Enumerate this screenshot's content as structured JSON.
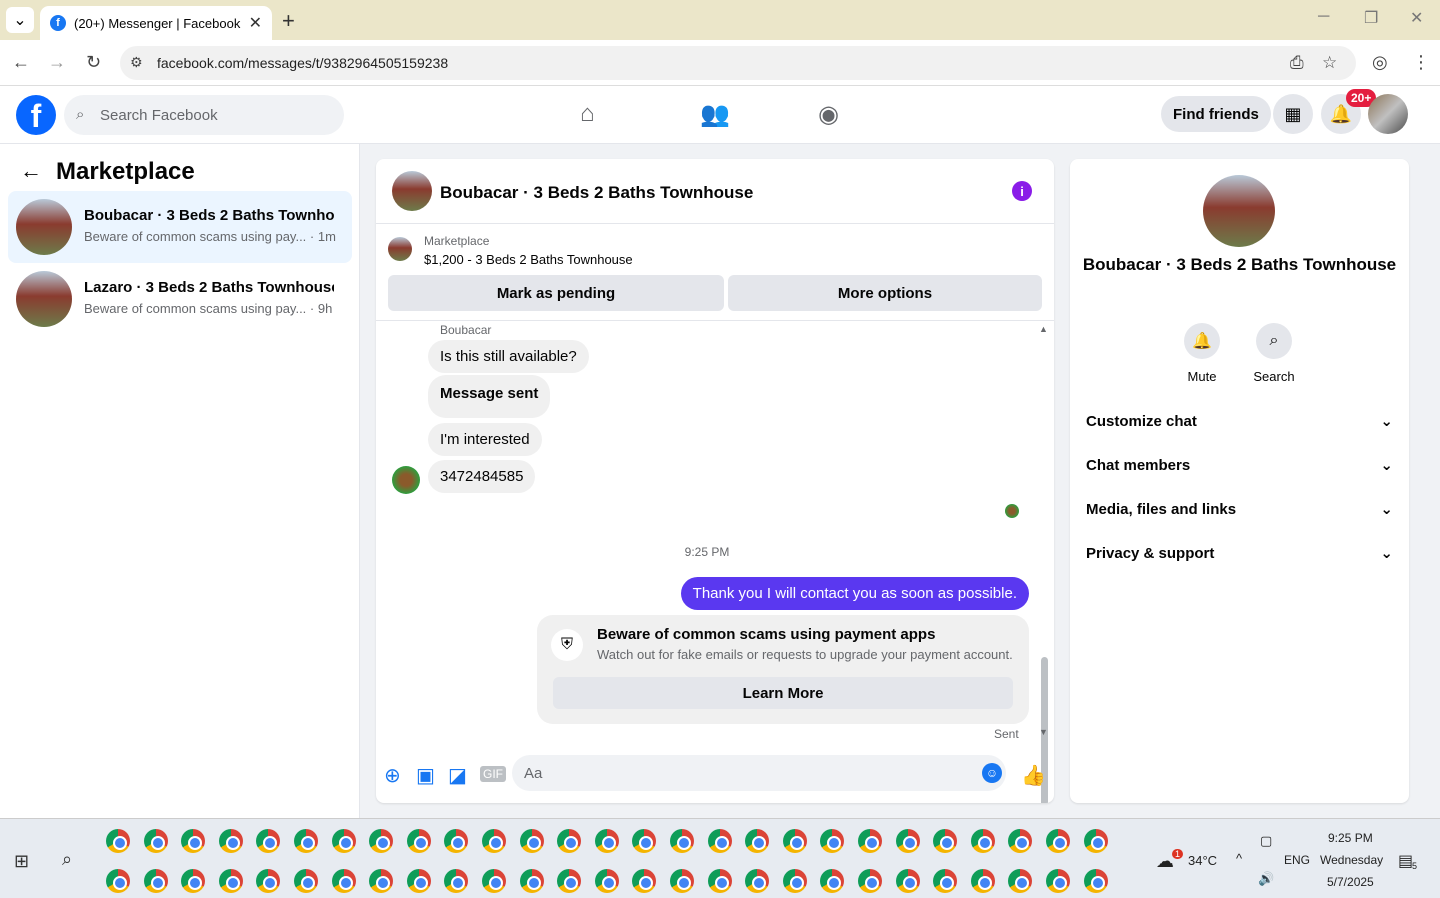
{
  "browser": {
    "tab_title": "(20+) Messenger | Facebook",
    "url": "facebook.com/messages/t/9382964505159238"
  },
  "fb": {
    "search_placeholder": "Search Facebook",
    "find_friends": "Find friends",
    "notif_badge": "20+"
  },
  "left": {
    "title": "Marketplace",
    "conversations": [
      {
        "name": "Boubacar · 3 Beds 2 Baths Townho...",
        "snippet": "Beware of common scams using pay... · 1m"
      },
      {
        "name": "Lazaro · 3 Beds 2 Baths Townhouse",
        "snippet": "Beware of common scams using pay... · 9h"
      }
    ]
  },
  "chat": {
    "title": "Boubacar · 3 Beds 2 Baths Townhouse",
    "listing_label": "Marketplace",
    "listing_price": "$1,200 - 3 Beds 2 Baths Townhouse",
    "mark_pending": "Mark as pending",
    "more_options": "More options",
    "sender": "Boubacar",
    "messages": [
      "Is this still available?",
      "Message sent",
      "I'm interested",
      "3472484585"
    ],
    "timestamp": "9:25 PM",
    "my_message": "Thank you I will contact  you as soon as possible.",
    "scam_title": "Beware of common scams using payment apps",
    "scam_desc": "Watch out for fake emails or requests to upgrade your payment account.",
    "learn_more": "Learn More",
    "sent_label": "Sent",
    "composer_placeholder": "Aa"
  },
  "right": {
    "name": "Boubacar · 3 Beds 2 Baths Townhouse",
    "mute": "Mute",
    "search": "Search",
    "sections": [
      "Customize chat",
      "Chat members",
      "Media, files and links",
      "Privacy & support"
    ]
  },
  "taskbar": {
    "temp": "34°C",
    "lang": "ENG",
    "time": "9:25 PM",
    "day": "Wednesday",
    "date": "5/7/2025",
    "weather_badge": "1",
    "notif_count": "5"
  }
}
